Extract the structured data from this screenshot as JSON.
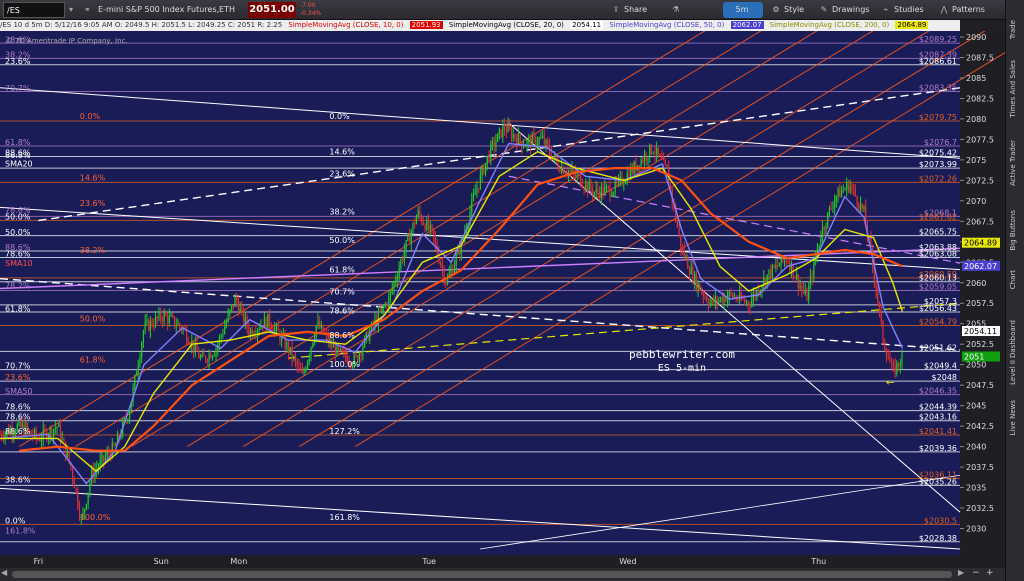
{
  "toolbar": {
    "symbol": "/ES",
    "product_title": "E-mini S&P 500 Index Futures,ETH",
    "last_price": "2051.00",
    "change_1": "-7.00",
    "change_2": "-0.34%",
    "share_label": "Share",
    "timeframe_label": "5m",
    "style_label": "Style",
    "drawings_label": "Drawings",
    "studies_label": "Studies",
    "patterns_label": "Patterns",
    "icons": {
      "share": "share-icon",
      "flask": "flask-icon",
      "style": "style-icon",
      "drawings": "pencil-icon",
      "studies": "studies-icon",
      "patterns": "patterns-icon"
    }
  },
  "study_bar": {
    "ohlc": "/ES 10 d 5m  D: 5/12/16 9:05 AM  O: 2049.5  H: 2051.5  L: 2049.25  C: 2051  R: 2.25",
    "sma10": "SimpleMovingAvg (CLOSE, 10, 0)",
    "sma10_value": "2051.93",
    "sma20": "SimpleMovingAvg (CLOSE, 20, 0)",
    "sma20_value": "2054.11",
    "sma50": "SimpleMovingAvg (CLOSE, 50, 0)",
    "sma50_value": "2062.07",
    "sma200": "SimpleMovingAvg (CLOSE, 200, 0)",
    "sma200_value": "2064.89",
    "colors": {
      "sma10": "#e00000",
      "sma20": "#000000",
      "sma50": "#4a3fd0",
      "sma200": "#8a8a00"
    }
  },
  "copyright": "© TD Ameritrade IP Company, Inc.",
  "watermark": {
    "line1": "pebblewriter.com",
    "line2": "ES 5-min"
  },
  "sidebar_tabs": [
    "Trade",
    "Times And Sales",
    "Active Trader",
    "Big Buttons",
    "Chart",
    "Dashboard",
    "Level II",
    "Live News"
  ],
  "chart_data": {
    "type": "candlestick",
    "ylim": [
      2027.5,
      2090
    ],
    "y_ticks": [
      2030,
      2032.5,
      2035,
      2037.5,
      2040,
      2042.5,
      2045,
      2047.5,
      2050,
      2052.5,
      2055,
      2057.5,
      2060,
      2062.5,
      2065,
      2067.5,
      2070,
      2072.5,
      2075,
      2077.5,
      2080,
      2082.5,
      2085,
      2087.5,
      2090
    ],
    "x_labels": [
      "Fri",
      "Sun",
      "Mon",
      "Tue",
      "Wed",
      "Thu"
    ],
    "price_path": [
      [
        0.0,
        2041.5
      ],
      [
        0.02,
        2042.5
      ],
      [
        0.04,
        2041.0
      ],
      [
        0.06,
        2042.5
      ],
      [
        0.075,
        2037.0
      ],
      [
        0.085,
        2030.8
      ],
      [
        0.095,
        2036.5
      ],
      [
        0.105,
        2038.0
      ],
      [
        0.12,
        2040.0
      ],
      [
        0.135,
        2044.5
      ],
      [
        0.15,
        2054.5
      ],
      [
        0.17,
        2056.0
      ],
      [
        0.19,
        2054.5
      ],
      [
        0.21,
        2050.5
      ],
      [
        0.225,
        2052.0
      ],
      [
        0.245,
        2058.0
      ],
      [
        0.26,
        2054.0
      ],
      [
        0.28,
        2055.5
      ],
      [
        0.3,
        2052.0
      ],
      [
        0.315,
        2048.5
      ],
      [
        0.33,
        2055.0
      ],
      [
        0.35,
        2051.5
      ],
      [
        0.37,
        2050.5
      ],
      [
        0.385,
        2054.0
      ],
      [
        0.405,
        2058.0
      ],
      [
        0.42,
        2063.5
      ],
      [
        0.435,
        2068.5
      ],
      [
        0.45,
        2066.0
      ],
      [
        0.465,
        2060.0
      ],
      [
        0.48,
        2064.5
      ],
      [
        0.495,
        2071.0
      ],
      [
        0.51,
        2076.0
      ],
      [
        0.525,
        2079.0
      ],
      [
        0.545,
        2077.0
      ],
      [
        0.565,
        2077.5
      ],
      [
        0.58,
        2074.5
      ],
      [
        0.6,
        2073.0
      ],
      [
        0.62,
        2071.0
      ],
      [
        0.64,
        2071.5
      ],
      [
        0.66,
        2074.0
      ],
      [
        0.68,
        2076.5
      ],
      [
        0.695,
        2073.5
      ],
      [
        0.71,
        2064.0
      ],
      [
        0.725,
        2060.0
      ],
      [
        0.74,
        2057.5
      ],
      [
        0.76,
        2058.5
      ],
      [
        0.78,
        2057.5
      ],
      [
        0.8,
        2061.0
      ],
      [
        0.82,
        2063.0
      ],
      [
        0.84,
        2058.0
      ],
      [
        0.855,
        2066.0
      ],
      [
        0.87,
        2070.5
      ],
      [
        0.885,
        2072.0
      ],
      [
        0.9,
        2068.5
      ],
      [
        0.91,
        2061.5
      ],
      [
        0.92,
        2053.0
      ],
      [
        0.93,
        2049.0
      ],
      [
        0.94,
        2051.0
      ]
    ],
    "ma_series": [
      {
        "name": "SMA10",
        "color": "#8080ff",
        "points": [
          [
            0.0,
            2041.0
          ],
          [
            0.05,
            2041.5
          ],
          [
            0.09,
            2035.5
          ],
          [
            0.12,
            2039.5
          ],
          [
            0.15,
            2050.0
          ],
          [
            0.19,
            2054.5
          ],
          [
            0.23,
            2052.0
          ],
          [
            0.26,
            2055.5
          ],
          [
            0.3,
            2053.0
          ],
          [
            0.34,
            2053.0
          ],
          [
            0.37,
            2051.5
          ],
          [
            0.41,
            2057.5
          ],
          [
            0.44,
            2066.0
          ],
          [
            0.47,
            2062.5
          ],
          [
            0.5,
            2070.0
          ],
          [
            0.53,
            2077.0
          ],
          [
            0.57,
            2076.5
          ],
          [
            0.61,
            2073.0
          ],
          [
            0.65,
            2072.5
          ],
          [
            0.69,
            2074.5
          ],
          [
            0.71,
            2066.5
          ],
          [
            0.73,
            2060.5
          ],
          [
            0.76,
            2058.0
          ],
          [
            0.79,
            2058.5
          ],
          [
            0.82,
            2062.0
          ],
          [
            0.85,
            2063.0
          ],
          [
            0.88,
            2070.5
          ],
          [
            0.9,
            2068.0
          ],
          [
            0.92,
            2057.0
          ],
          [
            0.94,
            2052.0
          ]
        ]
      },
      {
        "name": "SMA20",
        "color": "#e8e800",
        "points": [
          [
            0.0,
            2041.0
          ],
          [
            0.06,
            2041.0
          ],
          [
            0.1,
            2037.0
          ],
          [
            0.13,
            2040.0
          ],
          [
            0.16,
            2046.5
          ],
          [
            0.2,
            2052.5
          ],
          [
            0.24,
            2053.0
          ],
          [
            0.28,
            2054.0
          ],
          [
            0.32,
            2053.0
          ],
          [
            0.36,
            2052.5
          ],
          [
            0.4,
            2056.0
          ],
          [
            0.44,
            2062.5
          ],
          [
            0.48,
            2064.5
          ],
          [
            0.52,
            2073.0
          ],
          [
            0.56,
            2076.0
          ],
          [
            0.6,
            2074.0
          ],
          [
            0.65,
            2072.5
          ],
          [
            0.69,
            2074.0
          ],
          [
            0.72,
            2069.0
          ],
          [
            0.75,
            2062.0
          ],
          [
            0.78,
            2059.0
          ],
          [
            0.82,
            2061.0
          ],
          [
            0.85,
            2063.0
          ],
          [
            0.88,
            2066.5
          ],
          [
            0.91,
            2065.5
          ],
          [
            0.93,
            2060.0
          ],
          [
            0.94,
            2056.5
          ]
        ]
      },
      {
        "name": "SMA50",
        "color": "#ff5010",
        "points": [
          [
            0.02,
            2039.5
          ],
          [
            0.06,
            2040.0
          ],
          [
            0.1,
            2039.5
          ],
          [
            0.13,
            2039.5
          ],
          [
            0.16,
            2042.5
          ],
          [
            0.2,
            2047.5
          ],
          [
            0.24,
            2050.5
          ],
          [
            0.28,
            2053.5
          ],
          [
            0.32,
            2054.0
          ],
          [
            0.36,
            2053.5
          ],
          [
            0.4,
            2055.5
          ],
          [
            0.44,
            2059.0
          ],
          [
            0.48,
            2061.5
          ],
          [
            0.52,
            2066.5
          ],
          [
            0.56,
            2072.0
          ],
          [
            0.6,
            2073.5
          ],
          [
            0.64,
            2074.0
          ],
          [
            0.68,
            2074.0
          ],
          [
            0.71,
            2072.5
          ],
          [
            0.74,
            2068.5
          ],
          [
            0.78,
            2065.0
          ],
          [
            0.82,
            2063.0
          ],
          [
            0.85,
            2063.5
          ],
          [
            0.88,
            2064.0
          ],
          [
            0.91,
            2063.5
          ],
          [
            0.93,
            2062.5
          ],
          [
            0.94,
            2062.0
          ]
        ]
      }
    ],
    "price_levels": [
      {
        "label": "$2089.25",
        "value": 2089.25,
        "color": "#b07cc8"
      },
      {
        "label": "$2087.39",
        "value": 2087.39,
        "color": "#b07cc8"
      },
      {
        "label": "$2086.61",
        "value": 2086.61,
        "color": "#ffffff"
      },
      {
        "label": "$2083.35",
        "value": 2083.35,
        "color": "#b07cc8"
      },
      {
        "label": "$2079.75",
        "value": 2079.75,
        "color": "#e06020"
      },
      {
        "label": "$2076.7",
        "value": 2076.7,
        "color": "#b07cc8"
      },
      {
        "label": "$2075.42",
        "value": 2075.42,
        "color": "#ffffff"
      },
      {
        "label": "$2073.99",
        "value": 2073.99,
        "color": "#ffffff"
      },
      {
        "label": "$2072.26",
        "value": 2072.26,
        "color": "#e06020"
      },
      {
        "label": "$2068.1",
        "value": 2068.1,
        "color": "#b07cc8"
      },
      {
        "label": "$2067.62",
        "value": 2067.62,
        "color": "#e06020"
      },
      {
        "label": "$2065.75",
        "value": 2065.75,
        "color": "#ffffff"
      },
      {
        "label": "$2063.88",
        "value": 2063.88,
        "color": "#ffffff"
      },
      {
        "label": "$2063.08",
        "value": 2063.08,
        "color": "#ffffff"
      },
      {
        "label": "$2060.59",
        "value": 2060.59,
        "color": "#e06020"
      },
      {
        "label": "$2060.13",
        "value": 2060.13,
        "color": "#ffffff"
      },
      {
        "label": "$2059.05",
        "value": 2059.05,
        "color": "#b07cc8"
      },
      {
        "label": "$2057.3",
        "value": 2057.3,
        "color": "#ffffff"
      },
      {
        "label": "$2056.43",
        "value": 2056.43,
        "color": "#ffffff"
      },
      {
        "label": "$2054.79",
        "value": 2054.79,
        "color": "#e06020"
      },
      {
        "label": "$2051.62",
        "value": 2051.62,
        "color": "#ffffff"
      },
      {
        "label": "$2049.4",
        "value": 2049.4,
        "color": "#ffffff"
      },
      {
        "label": "$2048",
        "value": 2048.0,
        "color": "#ffffff"
      },
      {
        "label": "$2046.35",
        "value": 2046.35,
        "color": "#b07cc8"
      },
      {
        "label": "$2044.39",
        "value": 2044.39,
        "color": "#ffffff"
      },
      {
        "label": "$2043.16",
        "value": 2043.16,
        "color": "#ffffff"
      },
      {
        "label": "$2041.41",
        "value": 2041.41,
        "color": "#e06020"
      },
      {
        "label": "$2039.36",
        "value": 2039.36,
        "color": "#ffffff"
      },
      {
        "label": "$2036.11",
        "value": 2036.11,
        "color": "#e06020"
      },
      {
        "label": "$2035.26",
        "value": 2035.26,
        "color": "#ffffff"
      },
      {
        "label": "$2030.5",
        "value": 2030.5,
        "color": "#e06020"
      },
      {
        "label": "$2028.38",
        "value": 2028.38,
        "color": "#ffffff"
      }
    ],
    "current_price_tags": [
      {
        "label": "2064.89",
        "value": 2064.89,
        "bg": "#e8e800",
        "fg": "#000000"
      },
      {
        "label": "2062.07",
        "value": 2062.07,
        "bg": "#4a3fd0",
        "fg": "#ffffff"
      },
      {
        "label": "2054.11",
        "value": 2054.11,
        "bg": "#ffffff",
        "fg": "#000000"
      },
      {
        "label": "2051",
        "value": 2051.0,
        "bg": "#10a010",
        "fg": "#ffffff"
      }
    ],
    "fib_labels": [
      {
        "label": "0.0%",
        "value": 2079.75,
        "color": "#ff6030",
        "x": 0.08
      },
      {
        "label": "0.0%",
        "value": 2079.75,
        "color": "#ffffff",
        "x": 0.34
      },
      {
        "label": "14.6%",
        "value": 2075.42,
        "color": "#ffffff",
        "x": 0.34
      },
      {
        "label": "23.6%",
        "value": 2072.7,
        "color": "#ffffff",
        "x": 0.34
      },
      {
        "label": "38.2%",
        "value": 2068.1,
        "color": "#ffffff",
        "x": 0.34
      },
      {
        "label": "50.0%",
        "value": 2064.6,
        "color": "#ffffff",
        "x": 0.34
      },
      {
        "label": "61.8%",
        "value": 2061.0,
        "color": "#ffffff",
        "x": 0.34
      },
      {
        "label": "70.7%",
        "value": 2058.3,
        "color": "#ffffff",
        "x": 0.34
      },
      {
        "label": "78.6%",
        "value": 2056.0,
        "color": "#ffffff",
        "x": 0.34
      },
      {
        "label": "88.6%",
        "value": 2053.0,
        "color": "#ffffff",
        "x": 0.34
      },
      {
        "label": "100.0%",
        "value": 2049.5,
        "color": "#ffffff",
        "x": 0.34
      },
      {
        "label": "127.2%",
        "value": 2041.3,
        "color": "#ffffff",
        "x": 0.34
      },
      {
        "label": "161.8%",
        "value": 2030.8,
        "color": "#ffffff",
        "x": 0.34
      },
      {
        "label": "14.6%",
        "value": 2072.26,
        "color": "#ff6030",
        "x": 0.08
      },
      {
        "label": "23.6%",
        "value": 2069.1,
        "color": "#ff6030",
        "x": 0.08
      },
      {
        "label": "38.2%",
        "value": 2063.4,
        "color": "#ff6030",
        "x": 0.08
      },
      {
        "label": "50.0%",
        "value": 2055.0,
        "color": "#ff6030",
        "x": 0.08
      },
      {
        "label": "61.8%",
        "value": 2050.0,
        "color": "#ff6030",
        "x": 0.08
      },
      {
        "label": "100.0%",
        "value": 2030.8,
        "color": "#ff6030",
        "x": 0.08
      }
    ],
    "left_labels": [
      {
        "label": "28.6%",
        "value": 2089.2,
        "color": "#b07cc8"
      },
      {
        "label": "38.2%",
        "value": 2087.4,
        "color": "#b07cc8"
      },
      {
        "label": "23.6%",
        "value": 2086.6,
        "color": "#ffffff"
      },
      {
        "label": "70.7%",
        "value": 2083.3,
        "color": "#b07cc8"
      },
      {
        "label": "61.8%",
        "value": 2076.7,
        "color": "#b07cc8"
      },
      {
        "label": "88.6%",
        "value": 2075.4,
        "color": "#ffffff"
      },
      {
        "label": "86.8%",
        "value": 2075.1,
        "color": "#ffffff"
      },
      {
        "label": "SMA20",
        "value": 2074.1,
        "color": "#ffffff"
      },
      {
        "label": "78.6%",
        "value": 2068.4,
        "color": "#b07cc8"
      },
      {
        "label": "50.0%",
        "value": 2067.6,
        "color": "#ffffff"
      },
      {
        "label": "50.0%",
        "value": 2065.7,
        "color": "#ffffff"
      },
      {
        "label": "88.6%",
        "value": 2063.9,
        "color": "#b07cc8"
      },
      {
        "label": "78.6%",
        "value": 2063.1,
        "color": "#ffffff"
      },
      {
        "label": "SMA10",
        "value": 2061.9,
        "color": "#ff5050"
      },
      {
        "label": "78.2%",
        "value": 2059.2,
        "color": "#b07cc8"
      },
      {
        "label": "61.8%",
        "value": 2056.4,
        "color": "#ffffff"
      },
      {
        "label": "70.7%",
        "value": 2049.4,
        "color": "#ffffff"
      },
      {
        "label": "23.6%",
        "value": 2048.0,
        "color": "#ff6030"
      },
      {
        "label": "SMA50",
        "value": 2046.3,
        "color": "#b07cc8"
      },
      {
        "label": "78.6%",
        "value": 2044.4,
        "color": "#ffffff"
      },
      {
        "label": "78.6%",
        "value": 2043.2,
        "color": "#ffffff"
      },
      {
        "label": "88.6%",
        "value": 2041.4,
        "color": "#ffffff"
      },
      {
        "label": "38.6%",
        "value": 2035.5,
        "color": "#ffffff"
      },
      {
        "label": "0.0%",
        "value": 2030.5,
        "color": "#ffffff"
      },
      {
        "label": "161.8%",
        "value": 2029.3,
        "color": "#b07cc8"
      }
    ],
    "grid": false
  }
}
